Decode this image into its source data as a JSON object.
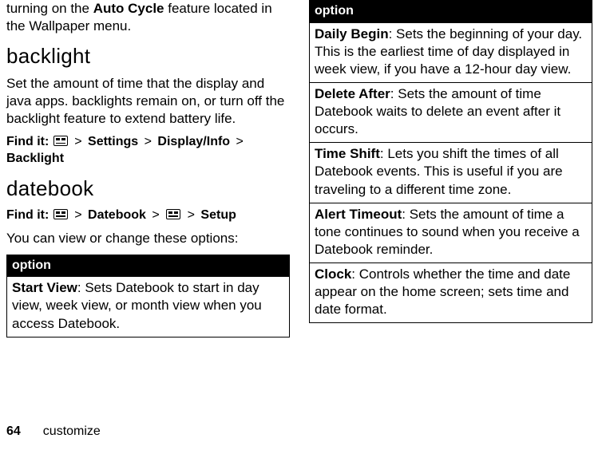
{
  "leftColumn": {
    "intro_pre": "turning on the ",
    "intro_strong": "Auto Cycle",
    "intro_post": " feature located in the Wallpaper menu.",
    "backlight_heading": "backlight",
    "backlight_body": "Set the amount of time that the display and java apps. backlights remain on, or turn off the backlight feature to extend battery life.",
    "findit_label": "Find it:",
    "backlight_path": [
      "Settings",
      "Display/Info",
      "Backlight"
    ],
    "datebook_heading": "datebook",
    "datebook_path_part1": "Datebook",
    "datebook_path_part2": "Setup",
    "datebook_body": "You can view or change these options:",
    "option_header": "option",
    "options_left": [
      {
        "label": "Start View",
        "desc": ": Sets Datebook to start in day view, week view, or month view when you access Datebook."
      }
    ]
  },
  "rightColumn": {
    "option_header": "option",
    "options_right": [
      {
        "label": "Daily Begin",
        "desc": ": Sets the beginning of your day. This is the earliest time of day displayed in week view, if you have a 12-hour day view."
      },
      {
        "label": "Delete After",
        "desc": ": Sets the amount of time Datebook waits to delete an event after it occurs."
      },
      {
        "label": "Time Shift",
        "desc": ": Lets you shift the times of all Datebook events. This is useful if you are traveling to a different time zone."
      },
      {
        "label": "Alert Timeout",
        "desc": ": Sets the amount of time a tone continues to sound when you receive a Datebook reminder."
      },
      {
        "label": "Clock",
        "desc": ": Controls whether the time and date appear on the home screen; sets time and date format."
      }
    ]
  },
  "footer": {
    "page": "64",
    "section": "customize"
  },
  "gt": ">"
}
